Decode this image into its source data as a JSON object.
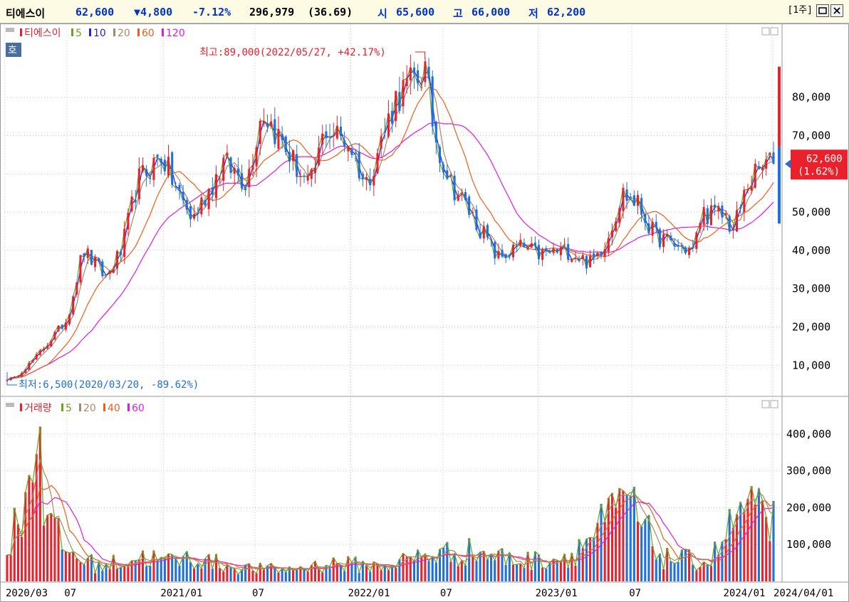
{
  "header": {
    "name": "티에스이",
    "price": "62,600",
    "change": "▼4,800",
    "rate": "-7.12%",
    "volume": "296,979",
    "volume_ratio": "(36.69)",
    "open_label": "시",
    "open": "65,600",
    "high_label": "고",
    "high": "66,000",
    "low_label": "저",
    "low": "62,200",
    "period_button": "[1주]",
    "restore_icon": "restore-icon",
    "close_icon": "close-icon"
  },
  "colors": {
    "up": "#e8212d",
    "down": "#1f6fdc",
    "ma5": "#6aa51e",
    "ma10": "#2323e6",
    "ma20": "#a58a6a",
    "ma60": "#f25c19",
    "ma120": "#e617e6",
    "header_bg": "#fdfbe3"
  },
  "chart_data": [
    {
      "type": "candlestick",
      "legend": [
        "티에스이",
        "5",
        "10",
        "20",
        "60",
        "120"
      ],
      "hoga_label": "호",
      "yticks": [
        "80,000",
        "70,000",
        "60,000",
        "50,000",
        "40,000",
        "30,000",
        "20,000",
        "10,000"
      ],
      "ylim": [
        3000,
        95000
      ],
      "annotations": {
        "high": "최고:89,000(2022/05/27, +42.17%)",
        "low": "최저:6,500(2020/03/20, -89.62%)"
      },
      "current_price_label": "62,600",
      "current_change_label": "(1.62%)",
      "price_keypoints": [
        [
          "2020-03-20",
          6500
        ],
        [
          "2020-05-01",
          12000
        ],
        [
          "2020-07-01",
          22000
        ],
        [
          "2020-08-01",
          40000
        ],
        [
          "2020-09-15",
          33000
        ],
        [
          "2020-10-15",
          40000
        ],
        [
          "2020-11-15",
          58000
        ],
        [
          "2021-01-01",
          65000
        ],
        [
          "2021-02-01",
          55000
        ],
        [
          "2021-03-01",
          48000
        ],
        [
          "2021-05-01",
          63000
        ],
        [
          "2021-06-15",
          58000
        ],
        [
          "2021-07-15",
          77000
        ],
        [
          "2021-09-01",
          66000
        ],
        [
          "2021-10-15",
          56000
        ],
        [
          "2021-11-15",
          72000
        ],
        [
          "2022-01-01",
          68000
        ],
        [
          "2022-02-01",
          57000
        ],
        [
          "2022-04-01",
          80000
        ],
        [
          "2022-05-27",
          87000
        ],
        [
          "2022-06-15",
          70000
        ],
        [
          "2022-07-15",
          58000
        ],
        [
          "2022-09-15",
          45000
        ],
        [
          "2022-10-15",
          38000
        ],
        [
          "2022-12-01",
          41000
        ],
        [
          "2023-01-01",
          39000
        ],
        [
          "2023-03-01",
          40000
        ],
        [
          "2023-04-15",
          36500
        ],
        [
          "2023-05-15",
          43000
        ],
        [
          "2023-06-15",
          55000
        ],
        [
          "2023-07-15",
          52000
        ],
        [
          "2023-08-15",
          44000
        ],
        [
          "2023-10-01",
          41000
        ],
        [
          "2023-11-01",
          40000
        ],
        [
          "2023-11-15",
          50000
        ],
        [
          "2024-01-01",
          49000
        ],
        [
          "2024-01-15",
          45000
        ],
        [
          "2024-02-15",
          58000
        ],
        [
          "2024-03-22",
          62600
        ]
      ]
    },
    {
      "type": "bar",
      "legend": [
        "거래량",
        "5",
        "20",
        "40",
        "60"
      ],
      "yticks": [
        "400,000",
        "300,000",
        "200,000",
        "100,000"
      ],
      "ylim": [
        0,
        450000
      ],
      "volume_keypoints": [
        [
          "2020-03-01",
          55000
        ],
        [
          "2020-05-08",
          420000
        ],
        [
          "2020-05-22",
          180000
        ],
        [
          "2020-07-01",
          90000
        ],
        [
          "2020-09-01",
          45000
        ],
        [
          "2020-12-01",
          75000
        ],
        [
          "2021-01-01",
          60000
        ],
        [
          "2021-03-01",
          70000
        ],
        [
          "2021-06-01",
          40000
        ],
        [
          "2021-09-01",
          35000
        ],
        [
          "2021-12-01",
          55000
        ],
        [
          "2022-03-01",
          45000
        ],
        [
          "2022-06-01",
          80000
        ],
        [
          "2022-09-01",
          90000
        ],
        [
          "2022-12-01",
          60000
        ],
        [
          "2023-03-01",
          75000
        ],
        [
          "2023-06-01",
          200000
        ],
        [
          "2023-06-22",
          235000
        ],
        [
          "2023-09-01",
          70000
        ],
        [
          "2023-12-01",
          60000
        ],
        [
          "2024-02-01",
          215000
        ],
        [
          "2024-03-22",
          175000
        ]
      ]
    }
  ],
  "xaxis": {
    "labels": [
      "2020/03",
      "07",
      "2021/01",
      "07",
      "2022/01",
      "07",
      "2023/01",
      "07",
      "2024/01",
      "2024/04/01"
    ]
  }
}
